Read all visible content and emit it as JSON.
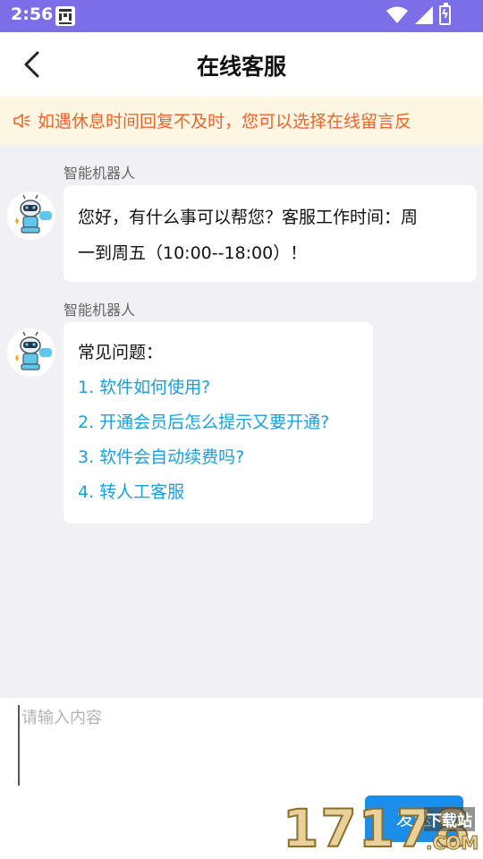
{
  "status_bar": {
    "time": "2:56",
    "battery_glyph": "ϟ"
  },
  "header": {
    "title": "在线客服"
  },
  "notice": {
    "text": "如遇休息时间回复不及时，您可以选择在线留言反"
  },
  "messages": [
    {
      "sender": "智能机器人",
      "line1": "您好，有什么事可以帮您？客服工作时间：周",
      "line2": "一到周五（10:00--18:00）！"
    },
    {
      "sender": "智能机器人",
      "heading": "常见问题：",
      "items": [
        "1. 软件如何使用?",
        "2. 开通会员后怎么提示又要开通?",
        "3. 软件会自动续费吗?",
        "4. 转人工客服"
      ]
    }
  ],
  "input": {
    "placeholder": "请输入内容",
    "send_label": "发送"
  },
  "watermark": {
    "digits": "17178",
    "site": "下载站",
    "domain": ".COM"
  },
  "colors": {
    "status_bar": "#7b6ee6",
    "notice_text": "#f0642a",
    "notice_bg": "#fdf6e3",
    "link": "#1aa0e0",
    "send_button": "#1a8ee8",
    "chat_bg": "#f0f0f5"
  }
}
